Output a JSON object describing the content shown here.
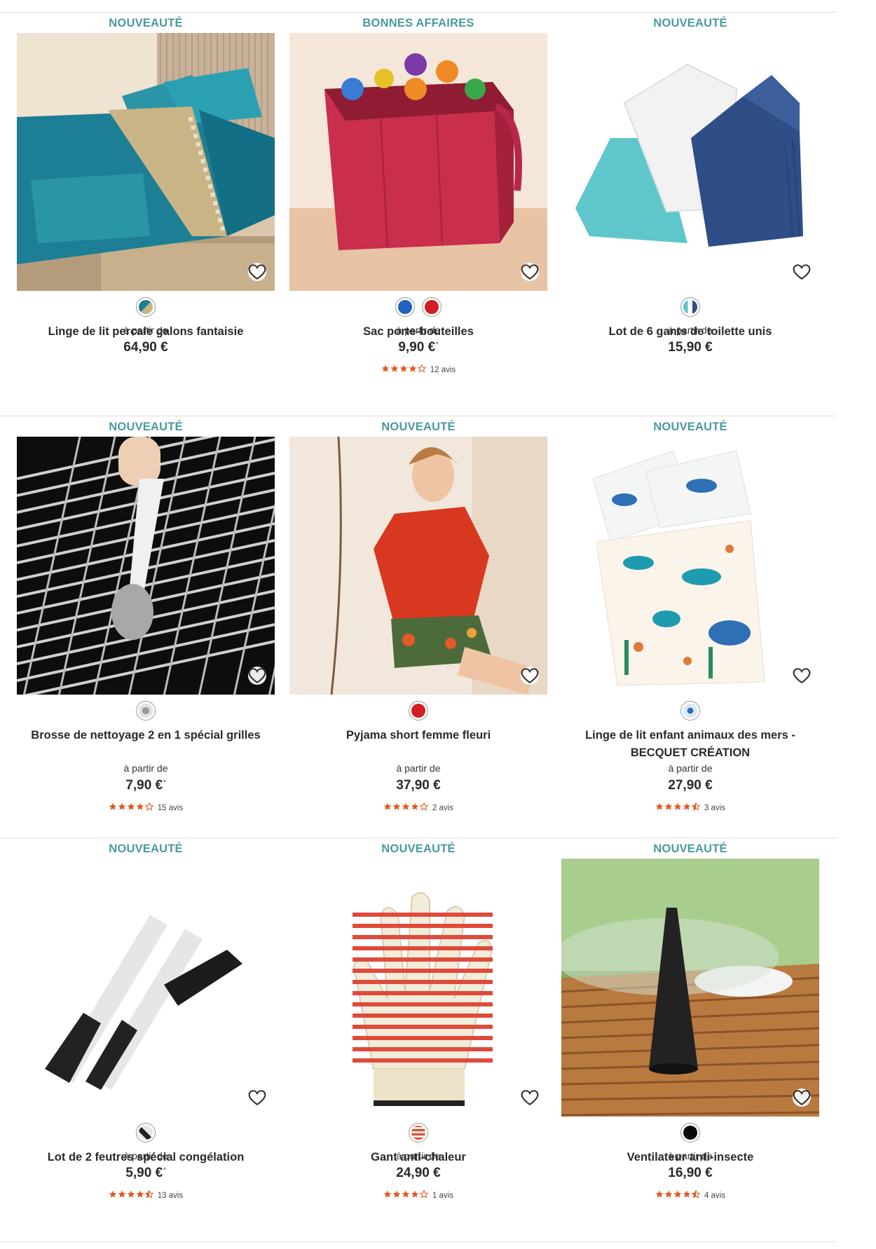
{
  "colors": {
    "badge": "#4a9aa0",
    "star": "#e05a1f",
    "divider": "#dcdcdc"
  },
  "products": [
    {
      "badge": "NOUVEAUTÉ",
      "name_lines": [
        "Linge de lit percale galons fantaisie"
      ],
      "from": "à partir de",
      "price": "64,90 €",
      "price_asterisk": "",
      "swatches": [
        "teal-pattern"
      ],
      "rating": null,
      "reviews": "",
      "image": "teal bed linen with patterned trim"
    },
    {
      "badge": "BONNES AFFAIRES",
      "name_lines": [
        "Sac porte-bouteilles"
      ],
      "from": "à partir de",
      "price": "9,90 €",
      "price_asterisk": "*",
      "swatches": [
        "blue",
        "red"
      ],
      "rating": 4,
      "reviews": "12 avis",
      "image": "red bottle carrier bag"
    },
    {
      "badge": "NOUVEAUTÉ",
      "name_lines": [
        "Lot de 6 gants de toilette unis"
      ],
      "from": "à partir de",
      "price": "15,90 €",
      "price_asterisk": "",
      "swatches": [
        "tricolor"
      ],
      "rating": null,
      "reviews": "",
      "image": "washcloths turquoise white navy"
    },
    {
      "badge": "NOUVEAUTÉ",
      "name_lines": [
        "Brosse de nettoyage 2 en 1 spécial grilles"
      ],
      "from": "à partir de",
      "price": "7,90 €",
      "price_asterisk": "*",
      "swatches": [
        "grey-pattern"
      ],
      "rating": 4,
      "reviews": "15 avis",
      "image": "grill cleaning brush"
    },
    {
      "badge": "NOUVEAUTÉ",
      "name_lines": [
        "Pyjama short femme fleuri"
      ],
      "from": "à partir de",
      "price": "37,90 €",
      "price_asterisk": "",
      "swatches": [
        "red"
      ],
      "rating": 4,
      "reviews": "2 avis",
      "image": "woman in red pyjama"
    },
    {
      "badge": "NOUVEAUTÉ",
      "name_lines": [
        "Linge de lit enfant animaux des mers -",
        "BECQUET CRÉATION"
      ],
      "from": "à partir de",
      "price": "27,90 €",
      "price_asterisk": "",
      "swatches": [
        "sea-pattern"
      ],
      "rating": 4.5,
      "reviews": "3 avis",
      "image": "children sea animals bedding"
    },
    {
      "badge": "NOUVEAUTÉ",
      "name_lines": [
        "Lot de 2 feutres spécial congélation"
      ],
      "from": "à partir de",
      "price": "5,90 €",
      "price_asterisk": "*",
      "swatches": [
        "marker-pattern"
      ],
      "rating": 4.5,
      "reviews": "13 avis",
      "image": "two black markers"
    },
    {
      "badge": "NOUVEAUTÉ",
      "name_lines": [
        "Gant anti-chaleur"
      ],
      "from": "à partir de",
      "price": "24,90 €",
      "price_asterisk": "",
      "swatches": [
        "stripe-pattern"
      ],
      "rating": 4,
      "reviews": "1 avis",
      "image": "heat resistant glove"
    },
    {
      "badge": "NOUVEAUTÉ",
      "name_lines": [
        "Ventilateur anti-insecte"
      ],
      "from": "à partir de",
      "price": "16,90 €",
      "price_asterisk": "",
      "swatches": [
        "black"
      ],
      "rating": 4.5,
      "reviews": "4 avis",
      "image": "anti-insect table fan"
    }
  ]
}
